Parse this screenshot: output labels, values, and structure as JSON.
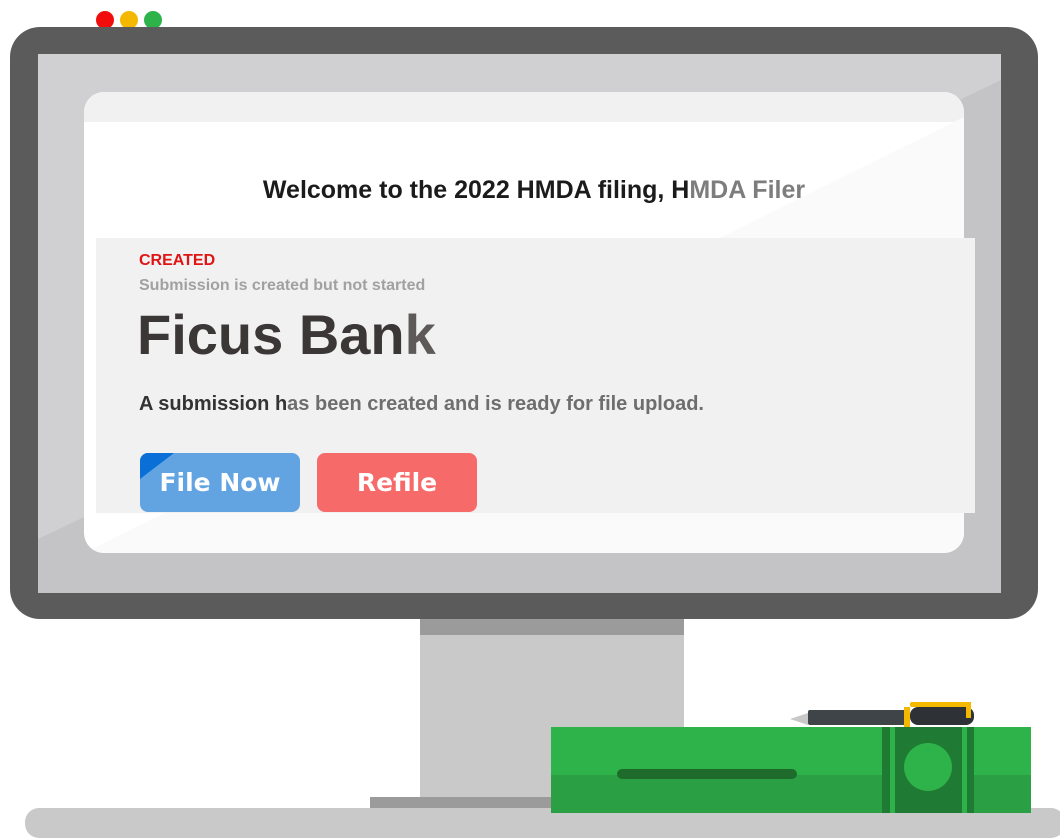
{
  "colors": {
    "monitor_frame": "#5b5b5b",
    "screen_bg": "#d0d0d2",
    "panel_bg": "#f1f1f1",
    "status_red": "#e01414",
    "file_now_blue": "#62a4e1",
    "refile_red": "#f66b6a",
    "cash_green": "#2eb24a"
  },
  "window_controls": [
    {
      "name": "close",
      "color": "#f20d0d"
    },
    {
      "name": "minimize",
      "color": "#f5b800"
    },
    {
      "name": "maximize",
      "color": "#2eb24a"
    }
  ],
  "welcome": {
    "text": "Welcome to the 2022 HMDA filing, H",
    "text_tail": "MDA Filer"
  },
  "submission": {
    "status": "CREATED",
    "status_description": "Submission is created but not started",
    "institution_name": "Ficus Ban",
    "institution_name_tail": "k",
    "message": "A submission h",
    "message_tail": "as been created and is ready for file upload."
  },
  "actions": {
    "file_now_label": "File Now",
    "refile_label": "Refile"
  }
}
